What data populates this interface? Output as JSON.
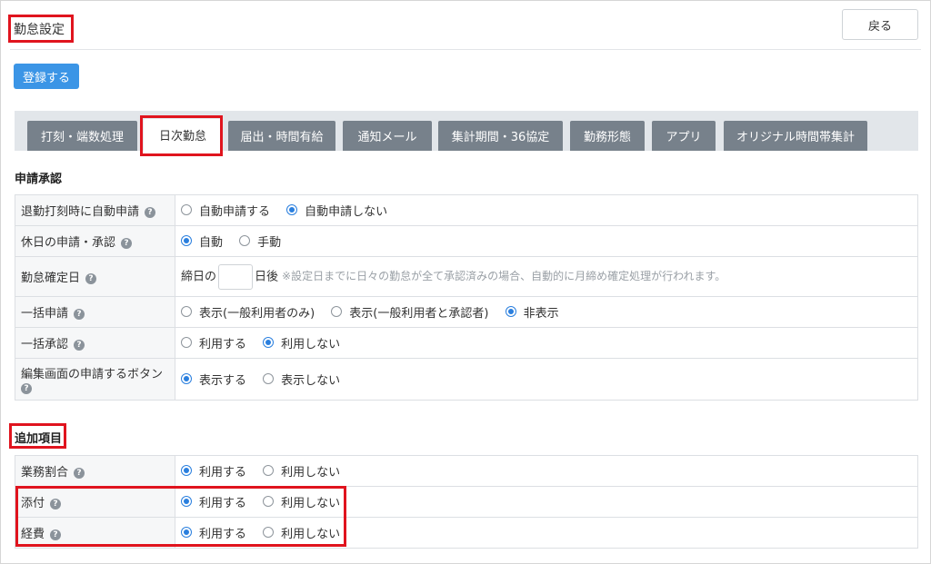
{
  "header": {
    "title": "勤怠設定",
    "back_label": "戻る"
  },
  "toolbar": {
    "register_label": "登録する"
  },
  "tabs": [
    {
      "label": "打刻・端数処理",
      "active": false
    },
    {
      "label": "日次勤怠",
      "active": true
    },
    {
      "label": "届出・時間有給",
      "active": false
    },
    {
      "label": "通知メール",
      "active": false
    },
    {
      "label": "集計期間・36協定",
      "active": false
    },
    {
      "label": "勤務形態",
      "active": false
    },
    {
      "label": "アプリ",
      "active": false
    },
    {
      "label": "オリジナル時間帯集計",
      "active": false
    }
  ],
  "help_glyph": "?",
  "approval_section": {
    "title": "申請承認",
    "rows": [
      {
        "label": "退勤打刻時に自動申請",
        "options": [
          {
            "label": "自動申請する",
            "checked": false
          },
          {
            "label": "自動申請しない",
            "checked": true
          }
        ]
      },
      {
        "label": "休日の申請・承認",
        "options": [
          {
            "label": "自動",
            "checked": true
          },
          {
            "label": "手動",
            "checked": false
          }
        ]
      },
      {
        "label": "勤怠確定日",
        "prefix": "締日の",
        "input_value": "",
        "suffix": "日後",
        "note": "※設定日までに日々の勤怠が全て承認済みの場合、自動的に月締め確定処理が行われます。"
      },
      {
        "label": "一括申請",
        "options": [
          {
            "label": "表示(一般利用者のみ)",
            "checked": false
          },
          {
            "label": "表示(一般利用者と承認者)",
            "checked": false
          },
          {
            "label": "非表示",
            "checked": true
          }
        ]
      },
      {
        "label": "一括承認",
        "options": [
          {
            "label": "利用する",
            "checked": false
          },
          {
            "label": "利用しない",
            "checked": true
          }
        ]
      },
      {
        "label": "編集画面の申請するボタン",
        "options": [
          {
            "label": "表示する",
            "checked": true
          },
          {
            "label": "表示しない",
            "checked": false
          }
        ]
      }
    ]
  },
  "additional_section": {
    "title": "追加項目",
    "rows": [
      {
        "label": "業務割合",
        "options": [
          {
            "label": "利用する",
            "checked": true
          },
          {
            "label": "利用しない",
            "checked": false
          }
        ]
      },
      {
        "label": "添付",
        "options": [
          {
            "label": "利用する",
            "checked": true
          },
          {
            "label": "利用しない",
            "checked": false
          }
        ]
      },
      {
        "label": "経費",
        "options": [
          {
            "label": "利用する",
            "checked": true
          },
          {
            "label": "利用しない",
            "checked": false
          }
        ]
      }
    ]
  },
  "colors": {
    "highlight": "#e0141e",
    "primary": "#3b95e6",
    "tab_inactive": "#77818b"
  }
}
